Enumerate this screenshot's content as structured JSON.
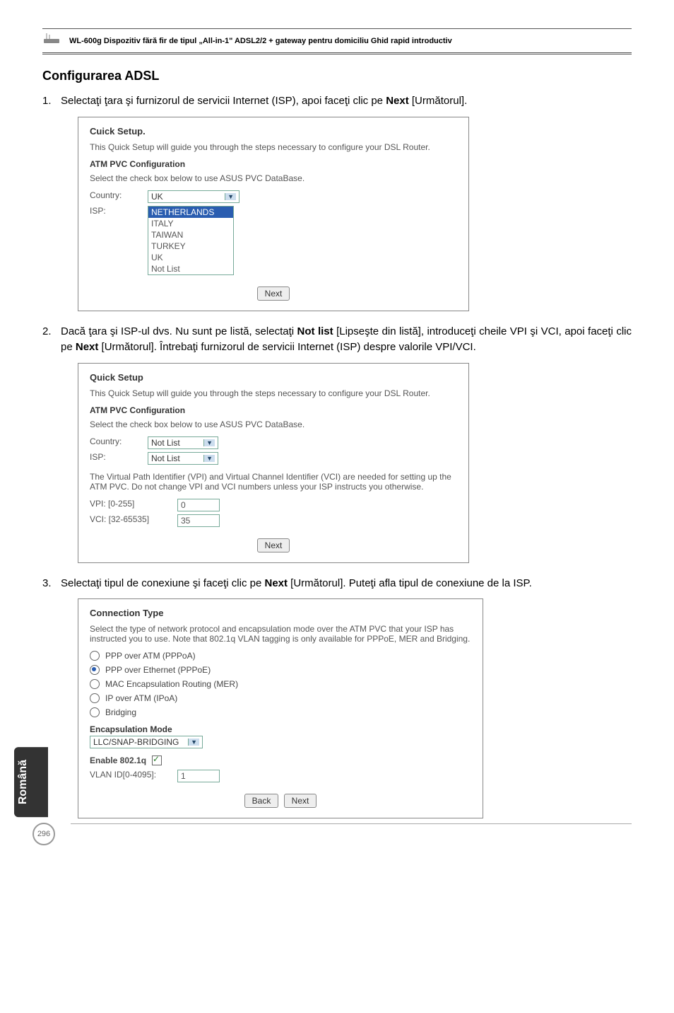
{
  "header": {
    "product_text": "WL-600g Dispozitiv fără fir de tipul „All-in-1\" ADSL2/2 + gateway pentru domiciliu Ghid rapid introductiv"
  },
  "section_title": "Configurarea ADSL",
  "steps": {
    "s1": {
      "num": "1.",
      "text_before_bold": "Selectaţi ţara şi furnizorul de servicii Internet (ISP), apoi faceţi clic pe ",
      "bold": "Next",
      "text_after_bold": " [Următorul]."
    },
    "s2": {
      "num": "2.",
      "part1": "Dacă ţara şi ISP-ul dvs. Nu sunt pe listă, selectaţi ",
      "bold1": "Not list",
      "part2": " [Lipseşte din listă], introduceţi cheile VPI şi VCI, apoi faceţi clic pe ",
      "bold2": "Next",
      "part3": " [Următorul]. Întrebaţi furnizorul de servicii Internet (ISP) despre valorile VPI/VCI."
    },
    "s3": {
      "num": "3.",
      "part1": "Selectaţi tipul de conexiune şi faceţi clic pe ",
      "bold1": "Next",
      "part2": " [Următorul]. Puteţi afla tipul de conexiune de la ISP."
    }
  },
  "shot1": {
    "title": "Cuick Setup.",
    "note": "This Quick Setup will guide you through the steps necessary to configure your DSL Router.",
    "subhead": "ATM PVC Configuration",
    "select_instr": "Select the check box below to use ASUS PVC DataBase.",
    "country_label": "Country:",
    "isp_label": "ISP:",
    "country_value": "UK",
    "isp_options": [
      "NETHERLANDS",
      "ITALY",
      "TAIWAN",
      "TURKEY",
      "UK",
      "Not List"
    ],
    "next_btn": "Next"
  },
  "shot2": {
    "title": "Quick Setup",
    "note": "This Quick Setup will guide you through the steps necessary to configure your DSL Router.",
    "subhead": "ATM PVC Configuration",
    "select_instr": "Select the check box below to use ASUS PVC DataBase.",
    "country_label": "Country:",
    "isp_label": "ISP:",
    "country_value": "Not List",
    "isp_value": "Not List",
    "vpi_note": "The Virtual Path Identifier (VPI) and Virtual Channel Identifier (VCI) are needed for setting up the ATM PVC. Do not change VPI and VCI numbers unless your ISP instructs you otherwise.",
    "vpi_label": "VPI: [0-255]",
    "vpi_value": "0",
    "vci_label": "VCI: [32-65535]",
    "vci_value": "35",
    "next_btn": "Next"
  },
  "shot3": {
    "title": "Connection Type",
    "note": "Select the type of network protocol and encapsulation mode over the ATM PVC that your ISP has instructed you to use. Note that 802.1q VLAN tagging is only available for PPPoE, MER and Bridging.",
    "opts": {
      "o1": "PPP over ATM (PPPoA)",
      "o2": "PPP over Ethernet (PPPoE)",
      "o3": "MAC Encapsulation Routing (MER)",
      "o4": "IP over ATM (IPoA)",
      "o5": "Bridging"
    },
    "encap_label": "Encapsulation Mode",
    "encap_value": "LLC/SNAP-BRIDGING",
    "enable_label": "Enable 802.1q",
    "vlan_label": "VLAN ID[0-4095]:",
    "vlan_value": "1",
    "back_btn": "Back",
    "next_btn": "Next"
  },
  "side_tab": "Română",
  "page_number": "296"
}
